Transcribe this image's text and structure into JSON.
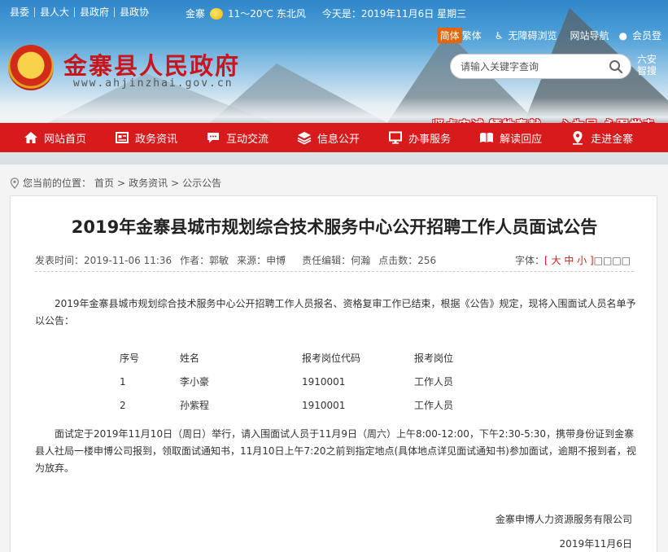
{
  "topbar": {
    "links": [
      "县委",
      "县人大",
      "县政府",
      "县政协"
    ],
    "weather_place": "金寨",
    "weather_temp": "11～20℃ 东北风",
    "today": "今天是：2019年11月6日 星期三"
  },
  "site": {
    "title": "金寨县人民政府",
    "url": "www.ahjinzhai.gov.cn"
  },
  "tools": {
    "simplified": "简体",
    "traditional": "繁体",
    "accessible": "无障碍浏览",
    "sitemap": "网站导航",
    "login": "会员登"
  },
  "search": {
    "placeholder": "请输入关键字查询"
  },
  "region": {
    "line1": "六安",
    "line2": "智搜"
  },
  "slogan": "坚贞忠诚  牺牲奉献  一心为民  永跟党走",
  "nav": {
    "items": [
      {
        "label": "网站首页",
        "icon": "home-icon"
      },
      {
        "label": "政务资讯",
        "icon": "news-icon"
      },
      {
        "label": "互动交流",
        "icon": "chat-icon"
      },
      {
        "label": "信息公开",
        "icon": "layers-icon"
      },
      {
        "label": "办事服务",
        "icon": "monitor-icon"
      },
      {
        "label": "解读回应",
        "icon": "book-icon"
      },
      {
        "label": "走进金寨",
        "icon": "map-icon"
      }
    ]
  },
  "breadcrumb": {
    "prefix": "您当前的位置：",
    "items": [
      "首页",
      "政务资讯",
      "公示公告"
    ],
    "sep": ">"
  },
  "article": {
    "title": "2019年金寨县城市规划综合技术服务中心公开招聘工作人员面试公告",
    "publish_label": "发表时间：2019-11-06 11:36",
    "author_label": "作者：郭敏",
    "source_label": "来源：申博",
    "editor_label": "责任编辑：何瀚",
    "clicks_label": "点击数：256",
    "font_label": "字体：",
    "font_sizes": "[ 大 中 小 ]",
    "font_boxes": "□□□□",
    "intro": "2019年金寨县城市规划综合技术服务中心公开招聘工作人员报名、资格复审工作已结束，根据《公告》规定，现将入围面试人员名单予以公告：",
    "table": {
      "headers": [
        "序号",
        "姓名",
        "报考岗位代码",
        "报考岗位"
      ],
      "rows": [
        [
          "1",
          "李小豪",
          "1910001",
          "工作人员"
        ],
        [
          "2",
          "孙紫程",
          "1910001",
          "工作人员"
        ]
      ]
    },
    "notice": "面试定于2019年11月10日（周日）举行，请入围面试人员于11月9日（周六）上午8:00-12:00，下午2:30-5:30，携带身份证到金寨县人社局一楼申博公司报到，领取面试通知书，11月10日上午7:20之前到指定地点(具体地点详见面试通知书)参加面试，逾期不报到者，视为放弃。",
    "signer": "金寨申博人力资源服务有限公司",
    "date": "2019年11月6日"
  }
}
